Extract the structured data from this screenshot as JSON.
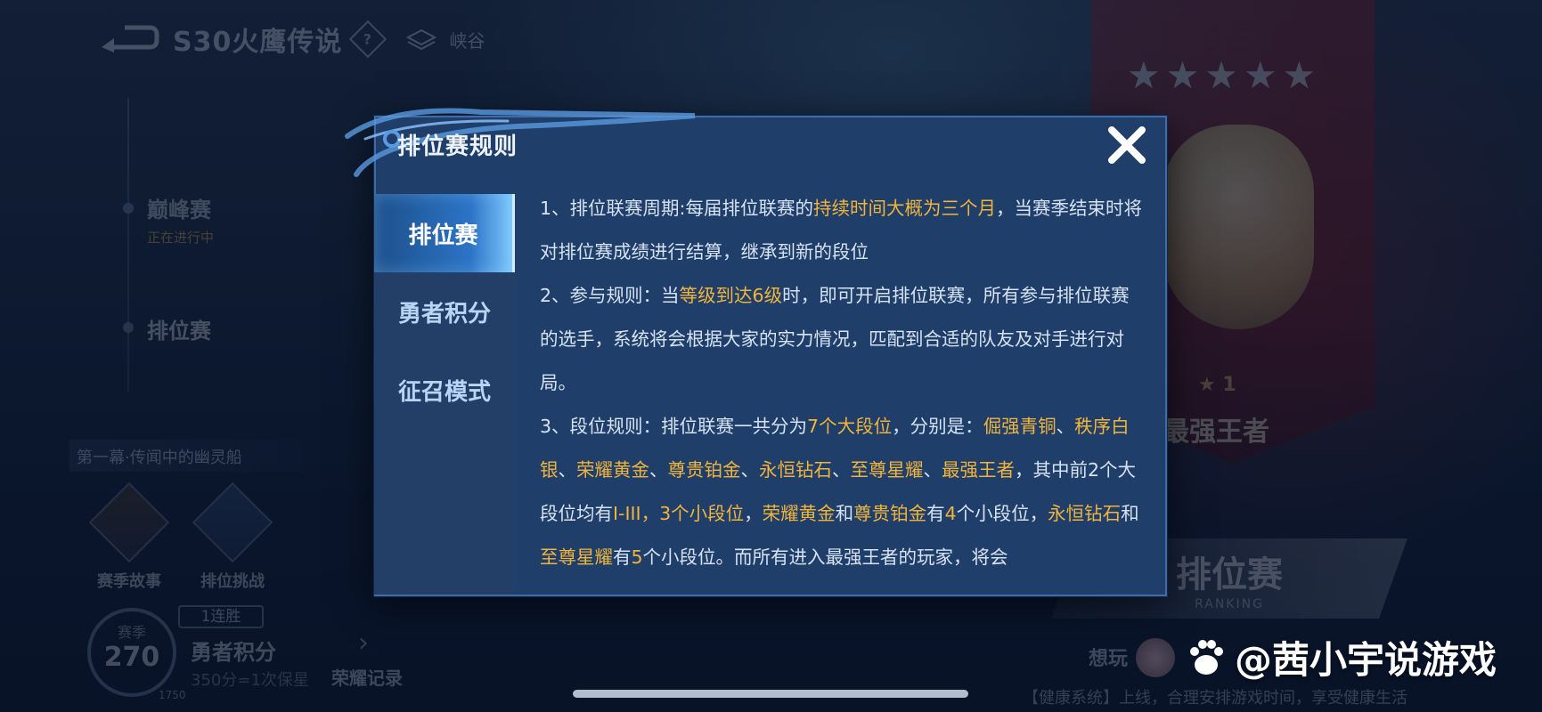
{
  "topbar": {
    "season_title": "S30火鹰传说",
    "help_glyph": "?",
    "map_label": "峡谷"
  },
  "left_nav": {
    "peak_label": "巅峰赛",
    "peak_status": "正在进行中",
    "rank_label": "排位赛",
    "story_banner": "第一幕·传闻中的幽灵船",
    "tiles": [
      {
        "label": "赛季故事"
      },
      {
        "label": "排位挑战"
      }
    ]
  },
  "bottom": {
    "season_label": "赛季",
    "season_value": "270",
    "season_sub": "1750",
    "streak": "1连胜",
    "brave_title": "勇者积分",
    "brave_sub": "350分=1次保星",
    "honor_record": "荣耀记录",
    "want_play": "想玩",
    "health_tip": "【健康系统】上线，合理安排游戏时间，享受健康生活",
    "watermark": "@茜小宇说游戏"
  },
  "right": {
    "stars": "★★★★★",
    "rank_star": "★ 1",
    "rank_name": "最强王者",
    "ranked_button": "排位赛",
    "ranked_button_sub": "RANKING"
  },
  "modal": {
    "title": "排位赛规则",
    "tabs": [
      {
        "label": "排位赛",
        "active": true
      },
      {
        "label": "勇者积分",
        "active": false
      },
      {
        "label": "征召模式",
        "active": false
      }
    ],
    "rules": [
      {
        "segments": [
          {
            "t": "1、排位联赛周期:每届排位联赛的",
            "hl": false
          },
          {
            "t": "持续时间大概为三个月",
            "hl": true
          },
          {
            "t": "，当赛季结束时将对排位赛成绩进行结算，继承到新的段位",
            "hl": false
          }
        ]
      },
      {
        "segments": [
          {
            "t": "2、参与规则：当",
            "hl": false
          },
          {
            "t": "等级到达6级",
            "hl": true
          },
          {
            "t": "时，即可开启排位联赛，所有参与排位联赛的选手，系统将会根据大家的实力情况，匹配到合适的队友及对手进行对局。",
            "hl": false
          }
        ]
      },
      {
        "segments": [
          {
            "t": "3、段位规则：排位联赛一共分为",
            "hl": false
          },
          {
            "t": "7个大段位",
            "hl": true
          },
          {
            "t": "，分别是：",
            "hl": false
          },
          {
            "t": "倔强青铜",
            "hl": true
          },
          {
            "t": "、",
            "hl": false
          },
          {
            "t": "秩序白银",
            "hl": true
          },
          {
            "t": "、",
            "hl": false
          },
          {
            "t": "荣耀黄金",
            "hl": true
          },
          {
            "t": "、",
            "hl": false
          },
          {
            "t": "尊贵铂金",
            "hl": true
          },
          {
            "t": "、",
            "hl": false
          },
          {
            "t": "永恒钻石",
            "hl": true
          },
          {
            "t": "、",
            "hl": false
          },
          {
            "t": "至尊星耀",
            "hl": true
          },
          {
            "t": "、",
            "hl": false
          },
          {
            "t": "最强王者",
            "hl": true
          },
          {
            "t": "，其中前2个大段位均有",
            "hl": false
          },
          {
            "t": "I-III，3个小段位",
            "hl": true
          },
          {
            "t": "，",
            "hl": false
          },
          {
            "t": "荣耀黄金",
            "hl": true
          },
          {
            "t": "和",
            "hl": false
          },
          {
            "t": "尊贵铂金",
            "hl": true
          },
          {
            "t": "有",
            "hl": false
          },
          {
            "t": "4",
            "hl": true
          },
          {
            "t": "个小段位，",
            "hl": false
          },
          {
            "t": "永恒钻石",
            "hl": true
          },
          {
            "t": "和",
            "hl": false
          },
          {
            "t": "至尊星耀",
            "hl": true
          },
          {
            "t": "有",
            "hl": false
          },
          {
            "t": "5",
            "hl": true
          },
          {
            "t": "个小段位。而所有进入最强王者的玩家，将会",
            "hl": false
          }
        ]
      }
    ]
  },
  "colors": {
    "highlight": "#f1b43c",
    "modal_bg": "#1f3e69",
    "tab_active": "#2c74c6"
  }
}
